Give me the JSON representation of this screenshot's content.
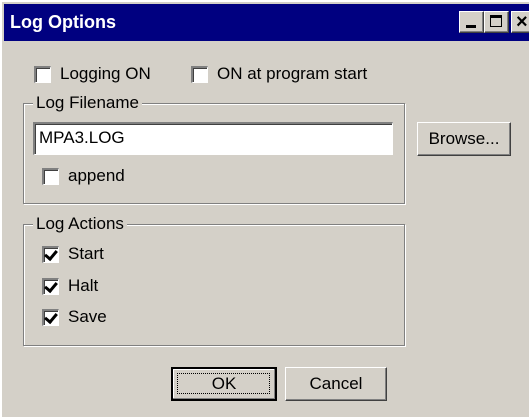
{
  "window": {
    "title": "Log Options",
    "controls": {
      "minimize_icon": "minimize-icon",
      "maximize_icon": "maximize-icon",
      "close_glyph": "×"
    }
  },
  "options": {
    "logging_on": {
      "label": "Logging ON",
      "checked": false
    },
    "on_at_start": {
      "label": "ON at program start",
      "checked": false
    }
  },
  "log_filename": {
    "legend": "Log Filename",
    "value": "MPA3.LOG",
    "browse_label": "Browse...",
    "append": {
      "label": "append",
      "checked": false
    }
  },
  "log_actions": {
    "legend": "Log Actions",
    "items": [
      {
        "label": "Start",
        "checked": true
      },
      {
        "label": "Halt",
        "checked": true
      },
      {
        "label": "Save",
        "checked": true
      }
    ]
  },
  "buttons": {
    "ok_label": "OK",
    "cancel_label": "Cancel"
  },
  "colors": {
    "titlebar": "#000080",
    "face": "#d4d0c8",
    "shadow": "#808080",
    "highlight": "#ffffff"
  }
}
